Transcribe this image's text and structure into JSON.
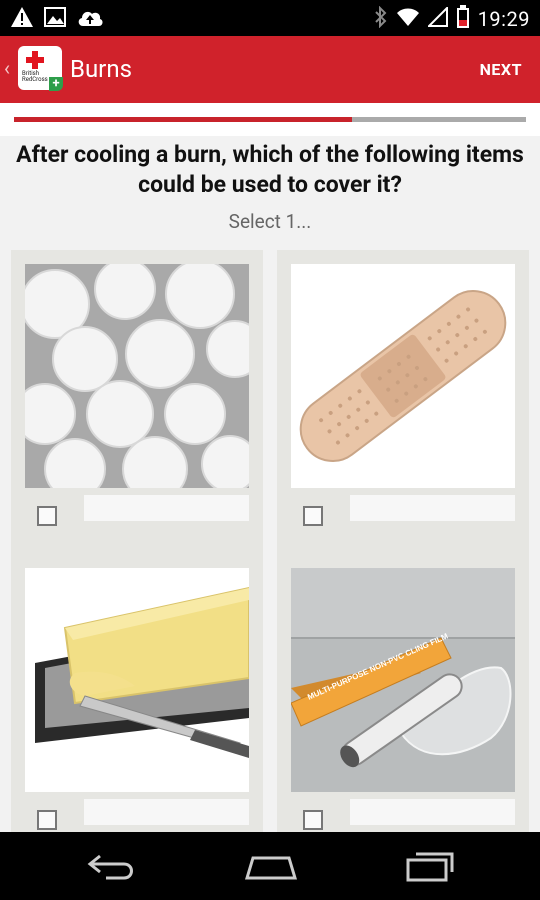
{
  "status_bar": {
    "time": "19:29",
    "left_icons": [
      "warning-icon",
      "image-icon",
      "cloud-upload-icon"
    ],
    "right_icons": [
      "bluetooth-icon",
      "wifi-icon",
      "signal-icon",
      "battery-icon"
    ]
  },
  "action_bar": {
    "title": "Burns",
    "next_label": "NEXT",
    "logo_text": "British RedCross",
    "accent_color": "#d0222b"
  },
  "progress": {
    "fraction": 0.66,
    "fill_color": "#c8232b",
    "track_color": "#aaaaaa"
  },
  "question": {
    "text": "After cooling a burn, which of the following items could be used to cover it?",
    "hint": "Select 1..."
  },
  "options": [
    {
      "image": "cotton-balls",
      "label": ""
    },
    {
      "image": "adhesive-plaster",
      "label": ""
    },
    {
      "image": "butter",
      "label": ""
    },
    {
      "image": "cling-film",
      "label": "",
      "package_text": "MULTI-PURPOSE NON-PVC CLING FILM"
    }
  ],
  "nav_bar": {
    "buttons": [
      "back-icon",
      "home-icon",
      "recent-apps-icon"
    ]
  }
}
